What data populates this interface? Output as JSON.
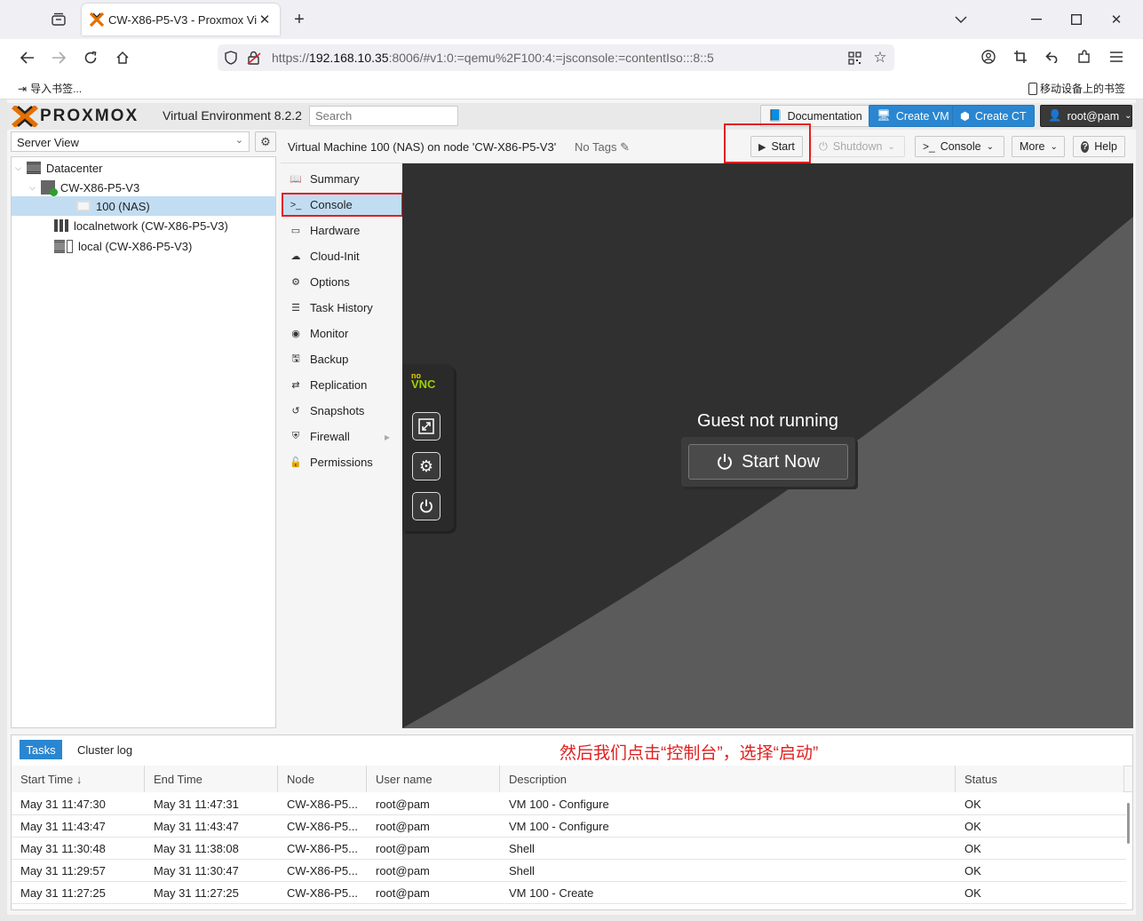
{
  "browser": {
    "tab_title": "CW-X86-P5-V3 - Proxmox Vi",
    "url_prefix": "https://",
    "url_host": "192.168.10.35",
    "url_rest": ":8006/#v1:0:=qemu%2F100:4:=jsconsole:=contentIso:::8::5",
    "bookmark_import": "导入书签...",
    "mobile_bookmarks": "移动设备上的书签"
  },
  "pve": {
    "brand": "PROXMOX",
    "version": "Virtual Environment 8.2.2",
    "search_placeholder": "Search",
    "documentation": "Documentation",
    "create_vm": "Create VM",
    "create_ct": "Create CT",
    "user": "root@pam",
    "server_view": "Server View",
    "tree": {
      "datacenter": "Datacenter",
      "node": "CW-X86-P5-V3",
      "vm": "100 (NAS)",
      "network": "localnetwork (CW-X86-P5-V3)",
      "storage": "local (CW-X86-P5-V3)"
    },
    "vm_title": "Virtual Machine 100 (NAS) on node 'CW-X86-P5-V3'",
    "no_tags": "No Tags",
    "toolbar": {
      "start": "Start",
      "shutdown": "Shutdown",
      "console": "Console",
      "more": "More",
      "help": "Help"
    },
    "menu": [
      "Summary",
      "Console",
      "Hardware",
      "Cloud-Init",
      "Options",
      "Task History",
      "Monitor",
      "Backup",
      "Replication",
      "Snapshots",
      "Firewall",
      "Permissions"
    ],
    "novnc": {
      "logo_top": "no",
      "logo_bottom": "VNC"
    },
    "guest_status": "Guest not running",
    "start_now": "Start Now",
    "tasks_tab": "Tasks",
    "cluster_log_tab": "Cluster log",
    "annotation": "然后我们点击“控制台”，选择“启动”",
    "columns": [
      "Start Time ↓",
      "End Time",
      "Node",
      "User name",
      "Description",
      "Status"
    ],
    "rows": [
      [
        "May 31 11:47:30",
        "May 31 11:47:31",
        "CW-X86-P5...",
        "root@pam",
        "VM 100 - Configure",
        "OK"
      ],
      [
        "May 31 11:43:47",
        "May 31 11:43:47",
        "CW-X86-P5...",
        "root@pam",
        "VM 100 - Configure",
        "OK"
      ],
      [
        "May 31 11:30:48",
        "May 31 11:38:08",
        "CW-X86-P5...",
        "root@pam",
        "Shell",
        "OK"
      ],
      [
        "May 31 11:29:57",
        "May 31 11:30:47",
        "CW-X86-P5...",
        "root@pam",
        "Shell",
        "OK"
      ],
      [
        "May 31 11:27:25",
        "May 31 11:27:25",
        "CW-X86-P5...",
        "root@pam",
        "VM 100 - Create",
        "OK"
      ]
    ]
  },
  "colors": {
    "accent": "#2a86d0",
    "highlight": "#e02020",
    "selected": "#c2ddf2",
    "orange": "#e57000"
  }
}
